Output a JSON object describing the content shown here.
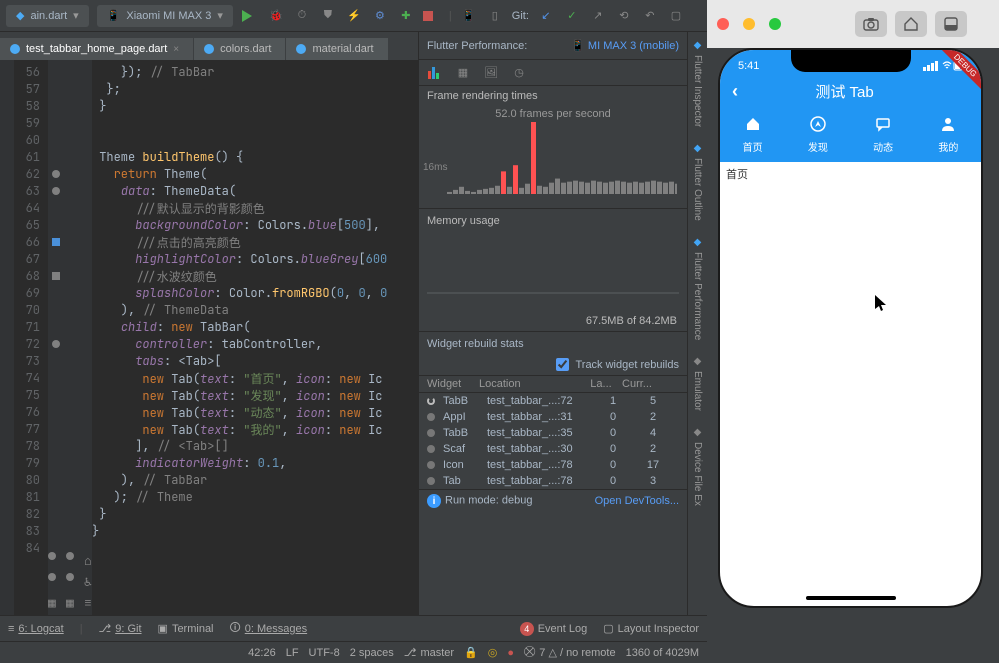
{
  "top_toolbar": {
    "config1": "ain.dart",
    "device": "Xiaomi MI MAX 3",
    "git_label": "Git:"
  },
  "file_tabs": [
    {
      "name": "test_tabbar_home_page.dart",
      "active": true
    },
    {
      "name": "colors.dart",
      "active": false
    },
    {
      "name": "material.dart",
      "active": false
    }
  ],
  "editor": {
    "line_start": 56,
    "lines": [
      {
        "n": 56,
        "html": "    <span class='punct'>}</span><span class='punct'>);</span> <span class='comment'>// TabBar</span>"
      },
      {
        "n": 57,
        "html": "  <span class='punct'>}</span><span class='punct'>;</span>"
      },
      {
        "n": 58,
        "html": " <span class='punct'>}</span>"
      },
      {
        "n": 59,
        "html": ""
      },
      {
        "n": 60,
        "html": ""
      },
      {
        "n": 61,
        "html": " <span class='cls'>Theme</span> <span class='type'>buildTheme</span><span class='punct'>() {</span>"
      },
      {
        "n": 62,
        "html": "   <span class='kw'>return</span> <span class='cls'>Theme</span><span class='punct'>(</span>"
      },
      {
        "n": 63,
        "html": "    <span class='prop'>data</span><span class='punct'>:</span> <span class='cls'>ThemeData</span><span class='punct'>(</span>"
      },
      {
        "n": 64,
        "html": "      <span class='comment'>///默认显示的背影颜色</span>"
      },
      {
        "n": 65,
        "html": "      <span class='prop'>backgroundColor</span><span class='punct'>:</span> <span class='cls'>Colors</span><span class='punct'>.</span><span class='prop'>blue</span><span class='punct'>[</span><span class='num'>500</span><span class='punct'>],</span>"
      },
      {
        "n": 66,
        "html": "      <span class='comment'>///点击的高亮颜色</span>"
      },
      {
        "n": 67,
        "html": "      <span class='prop'>highlightColor</span><span class='punct'>:</span> <span class='cls'>Colors</span><span class='punct'>.</span><span class='prop'>blueGrey</span><span class='punct'>[</span><span class='num'>600</span>"
      },
      {
        "n": 68,
        "html": "      <span class='comment'>///水波纹颜色</span>"
      },
      {
        "n": 69,
        "html": "      <span class='prop'>splashColor</span><span class='punct'>:</span> <span class='cls'>Color</span><span class='punct'>.</span><span class='type'>fromRGBO</span><span class='punct'>(</span><span class='num'>0</span><span class='punct'>, </span><span class='num'>0</span><span class='punct'>, </span><span class='num'>0</span>"
      },
      {
        "n": 70,
        "html": "    <span class='punct'>),</span> <span class='comment'>// ThemeData</span>"
      },
      {
        "n": 71,
        "html": "    <span class='prop'>child</span><span class='punct'>:</span> <span class='kw'>new</span> <span class='cls'>TabBar</span><span class='punct'>(</span>"
      },
      {
        "n": 72,
        "html": "      <span class='prop'>controller</span><span class='punct'>:</span> <span class='cls'>tabController</span><span class='punct'>,</span>"
      },
      {
        "n": 73,
        "html": "      <span class='prop'>tabs</span><span class='punct'>:</span> <span class='punct'>&lt;</span><span class='cls'>Tab</span><span class='punct'>&gt;[</span>"
      },
      {
        "n": 74,
        "html": "       <span class='kw'>new</span> <span class='cls'>Tab</span><span class='punct'>(</span><span class='prop'>text</span><span class='punct'>:</span> <span class='str'>\"首页\"</span><span class='punct'>,</span> <span class='prop'>icon</span><span class='punct'>:</span> <span class='kw'>new</span> <span class='cls'>Ic</span>"
      },
      {
        "n": 75,
        "html": "       <span class='kw'>new</span> <span class='cls'>Tab</span><span class='punct'>(</span><span class='prop'>text</span><span class='punct'>:</span> <span class='str'>\"发现\"</span><span class='punct'>,</span> <span class='prop'>icon</span><span class='punct'>:</span> <span class='kw'>new</span> <span class='cls'>Ic</span>"
      },
      {
        "n": 76,
        "html": "       <span class='kw'>new</span> <span class='cls'>Tab</span><span class='punct'>(</span><span class='prop'>text</span><span class='punct'>:</span> <span class='str'>\"动态\"</span><span class='punct'>,</span> <span class='prop'>icon</span><span class='punct'>:</span> <span class='kw'>new</span> <span class='cls'>Ic</span>"
      },
      {
        "n": 77,
        "html": "       <span class='kw'>new</span> <span class='cls'>Tab</span><span class='punct'>(</span><span class='prop'>text</span><span class='punct'>:</span> <span class='str'>\"我的\"</span><span class='punct'>,</span> <span class='prop'>icon</span><span class='punct'>:</span> <span class='kw'>new</span> <span class='cls'>Ic</span>"
      },
      {
        "n": 78,
        "html": "      <span class='punct'>],</span> <span class='comment'>// &lt;Tab&gt;[]</span>"
      },
      {
        "n": 79,
        "html": "      <span class='prop'>indicatorWeight</span><span class='punct'>:</span> <span class='num'>0.1</span><span class='punct'>,</span>"
      },
      {
        "n": 80,
        "html": "    <span class='punct'>),</span> <span class='comment'>// TabBar</span>"
      },
      {
        "n": 81,
        "html": "   <span class='punct'>);</span> <span class='comment'>// Theme</span>"
      },
      {
        "n": 82,
        "html": " <span class='punct'>}</span>"
      },
      {
        "n": 83,
        "html": "<span class='punct'>}</span>"
      },
      {
        "n": 84,
        "html": ""
      }
    ]
  },
  "perf": {
    "title": "Flutter Performance:",
    "device": "MI MAX 3 (mobile)",
    "frame_label": "Frame rendering times",
    "fps": "52.0 frames per second",
    "y_label": "16ms",
    "mem_label": "Memory usage",
    "mem_usage": "67.5MB of 84.2MB",
    "rebuild_label": "Widget rebuild stats",
    "track_label": "Track widget rebuilds",
    "track_checked": true,
    "table": {
      "headers": [
        "Widget",
        "Location",
        "La...",
        "Curr..."
      ],
      "rows": [
        {
          "spin": true,
          "widget": "TabB",
          "loc": "test_tabbar_...:72",
          "last": 1,
          "curr": 5
        },
        {
          "spin": false,
          "widget": "AppI",
          "loc": "test_tabbar_...:31",
          "last": 0,
          "curr": 2
        },
        {
          "spin": false,
          "widget": "TabB",
          "loc": "test_tabbar_...:35",
          "last": 0,
          "curr": 4
        },
        {
          "spin": false,
          "widget": "Scaf",
          "loc": "test_tabbar_...:30",
          "last": 0,
          "curr": 2
        },
        {
          "spin": false,
          "widget": "Icon",
          "loc": "test_tabbar_...:78",
          "last": 0,
          "curr": 17
        },
        {
          "spin": false,
          "widget": "Tab",
          "loc": "test_tabbar_...:78",
          "last": 0,
          "curr": 3
        }
      ]
    },
    "run_mode": "Run mode: debug",
    "devtools": "Open DevTools..."
  },
  "side_tools": [
    "Flutter Inspector",
    "Flutter Outline",
    "Flutter Performance",
    "Emulator",
    "Device File Ex"
  ],
  "bottom": {
    "logcat": "6: Logcat",
    "git": "9: Git",
    "terminal": "Terminal",
    "messages": "0: Messages",
    "event_log": "Event Log",
    "event_badge": "4",
    "layout": "Layout Inspector"
  },
  "status": {
    "cursor": "42:26",
    "lf": "LF",
    "enc": "UTF-8",
    "spaces": "2 spaces",
    "branch": "master",
    "analyze": "7 △ / no remote",
    "mem": "1360 of 4029M"
  },
  "phone": {
    "time": "5:41",
    "title": "测试 Tab",
    "tabs": [
      {
        "icon": "home",
        "label": "首页"
      },
      {
        "icon": "explore",
        "label": "发现"
      },
      {
        "icon": "chat",
        "label": "动态"
      },
      {
        "icon": "person",
        "label": "我的"
      }
    ],
    "content": "首页",
    "debug": "DEBUG"
  },
  "chart_data": {
    "type": "bar",
    "title": "Frame rendering times",
    "fps": 52.0,
    "ylabel": "16ms",
    "values_ms": [
      2,
      4,
      7,
      3,
      2,
      4,
      5,
      6,
      8,
      22,
      7,
      28,
      6,
      10,
      70,
      8,
      7,
      11,
      15,
      11,
      12,
      13,
      12,
      11,
      13,
      12,
      11,
      12,
      13,
      12,
      11,
      12,
      11,
      12,
      13,
      12,
      11,
      12,
      10
    ],
    "threshold_ms": 16
  }
}
